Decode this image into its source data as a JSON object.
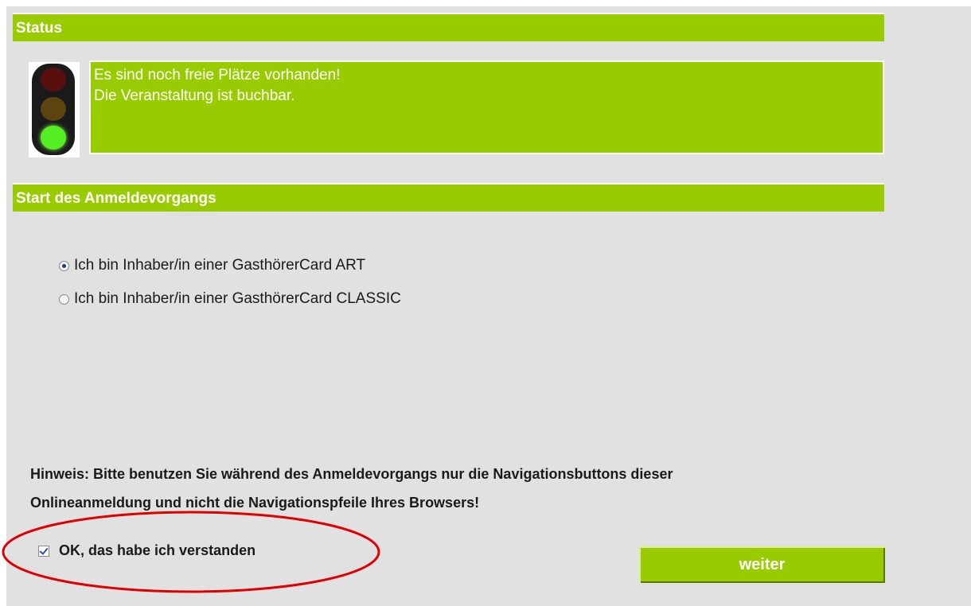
{
  "status_section": {
    "title": "Status",
    "message_line1": "Es sind noch freie Plätze vorhanden!",
    "message_line2": "Die Veranstaltung ist buchbar.",
    "traffic_light_state": "green"
  },
  "registration_section": {
    "title": "Start des Anmeldevorgangs",
    "options": [
      {
        "label": "Ich bin Inhaber/in einer GasthörerCard ART",
        "selected": true
      },
      {
        "label": "Ich bin Inhaber/in einer GasthörerCard CLASSIC",
        "selected": false
      }
    ]
  },
  "notice": {
    "line1": "Hinweis: Bitte benutzen Sie während des Anmeldevorgangs nur die Navigationsbuttons dieser",
    "line2": "Onlineanmeldung und nicht die Navigationspfeile Ihres Browsers!"
  },
  "confirm": {
    "label": "OK, das habe ich verstanden",
    "checked": true
  },
  "weiter_button": {
    "label": "weiter"
  },
  "colors": {
    "accent": "#99cc00",
    "panel": "#e1e1e1",
    "annotation": "#e00000"
  },
  "icons": [
    "traffic-light-icon",
    "radio-icon",
    "checkbox-icon"
  ]
}
